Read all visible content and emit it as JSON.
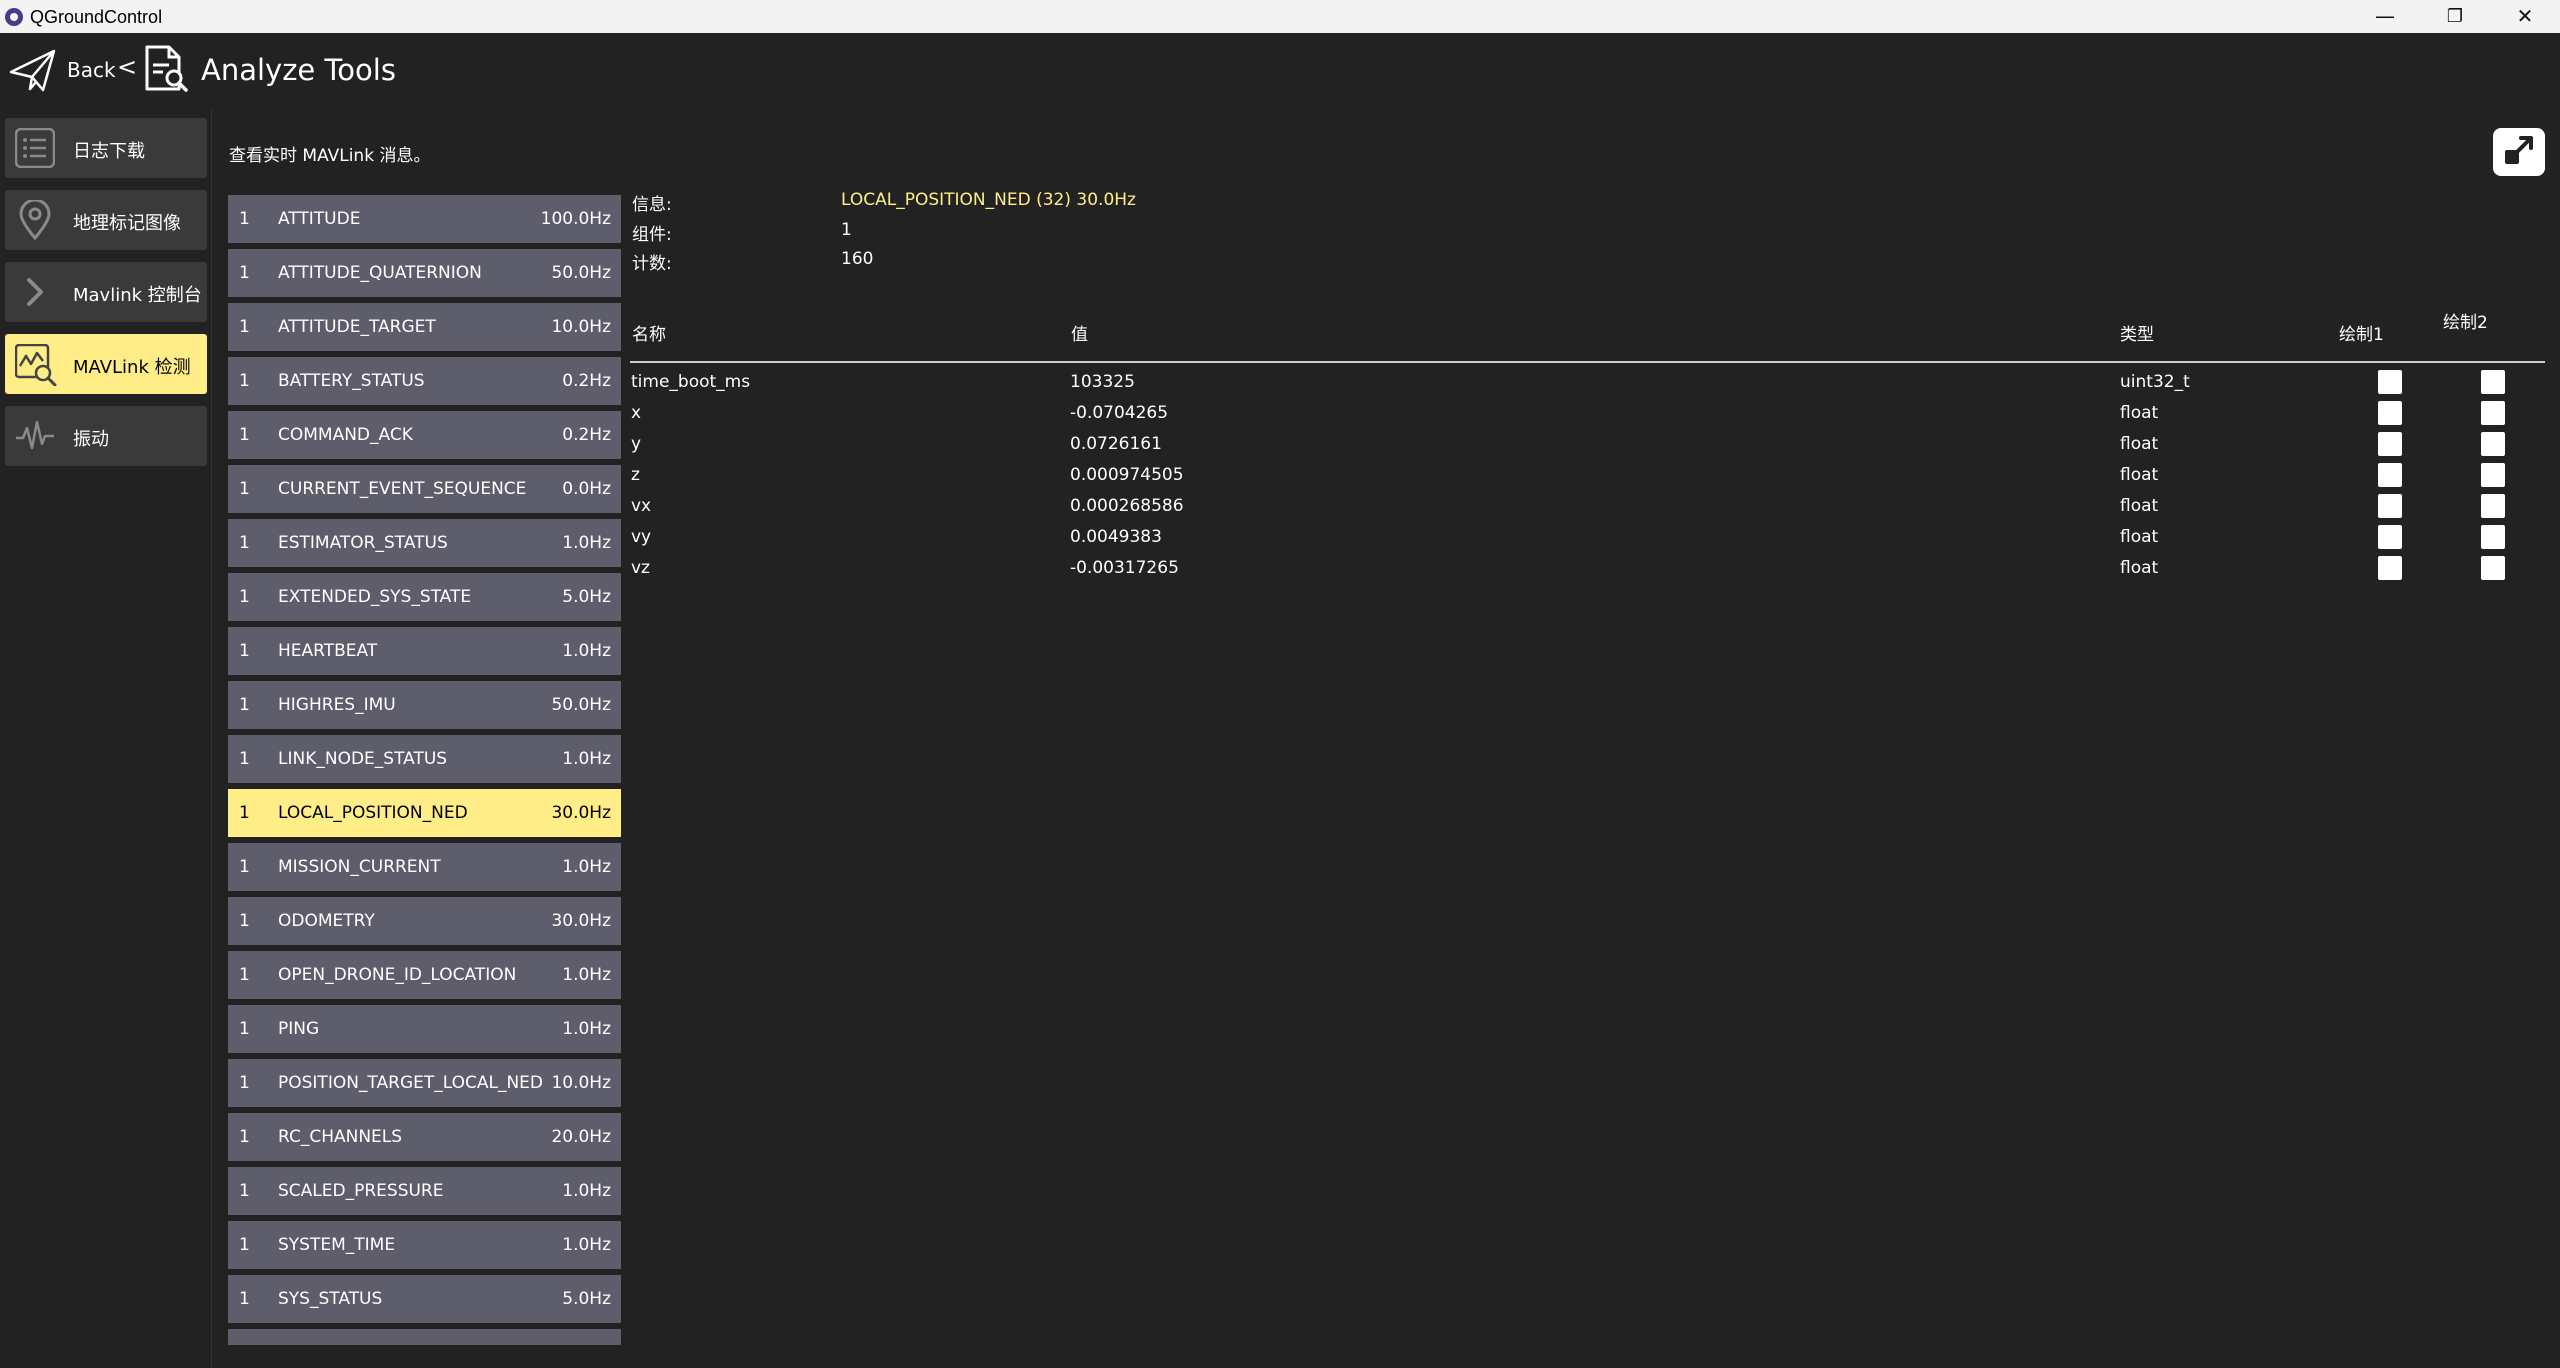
{
  "window": {
    "title": "QGroundControl",
    "minimize": "—",
    "maximize": "❐",
    "close": "✕"
  },
  "header": {
    "back_label": "Back",
    "chevron": "<",
    "page_title": "Analyze Tools"
  },
  "sidebar": {
    "items": [
      {
        "label": "日志下载",
        "icon": "list-icon",
        "active": false
      },
      {
        "label": "地理标记图像",
        "icon": "map-pin-icon",
        "active": false
      },
      {
        "label": "Mavlink 控制台",
        "icon": "chevron-right-icon",
        "active": false
      },
      {
        "label": "MAVLink 检测",
        "icon": "chart-inspect-icon",
        "active": true
      },
      {
        "label": "振动",
        "icon": "waveform-icon",
        "active": false
      }
    ]
  },
  "description": "查看实时 MAVLink 消息。",
  "messages": [
    {
      "comp": "1",
      "name": "ATTITUDE",
      "rate": "100.0Hz"
    },
    {
      "comp": "1",
      "name": "ATTITUDE_QUATERNION",
      "rate": "50.0Hz"
    },
    {
      "comp": "1",
      "name": "ATTITUDE_TARGET",
      "rate": "10.0Hz"
    },
    {
      "comp": "1",
      "name": "BATTERY_STATUS",
      "rate": "0.2Hz"
    },
    {
      "comp": "1",
      "name": "COMMAND_ACK",
      "rate": "0.2Hz"
    },
    {
      "comp": "1",
      "name": "CURRENT_EVENT_SEQUENCE",
      "rate": "0.0Hz"
    },
    {
      "comp": "1",
      "name": "ESTIMATOR_STATUS",
      "rate": "1.0Hz"
    },
    {
      "comp": "1",
      "name": "EXTENDED_SYS_STATE",
      "rate": "5.0Hz"
    },
    {
      "comp": "1",
      "name": "HEARTBEAT",
      "rate": "1.0Hz"
    },
    {
      "comp": "1",
      "name": "HIGHRES_IMU",
      "rate": "50.0Hz"
    },
    {
      "comp": "1",
      "name": "LINK_NODE_STATUS",
      "rate": "1.0Hz"
    },
    {
      "comp": "1",
      "name": "LOCAL_POSITION_NED",
      "rate": "30.0Hz",
      "selected": true
    },
    {
      "comp": "1",
      "name": "MISSION_CURRENT",
      "rate": "1.0Hz"
    },
    {
      "comp": "1",
      "name": "ODOMETRY",
      "rate": "30.0Hz"
    },
    {
      "comp": "1",
      "name": "OPEN_DRONE_ID_LOCATION",
      "rate": "1.0Hz"
    },
    {
      "comp": "1",
      "name": "PING",
      "rate": "1.0Hz"
    },
    {
      "comp": "1",
      "name": "POSITION_TARGET_LOCAL_NED",
      "rate": "10.0Hz"
    },
    {
      "comp": "1",
      "name": "RC_CHANNELS",
      "rate": "20.0Hz"
    },
    {
      "comp": "1",
      "name": "SCALED_PRESSURE",
      "rate": "1.0Hz"
    },
    {
      "comp": "1",
      "name": "SYSTEM_TIME",
      "rate": "1.0Hz"
    },
    {
      "comp": "1",
      "name": "SYS_STATUS",
      "rate": "5.0Hz"
    },
    {
      "comp": "",
      "name": "",
      "rate": ""
    }
  ],
  "detail": {
    "message_label": "信息:",
    "message_value": "LOCAL_POSITION_NED (32) 30.0Hz",
    "component_label": "组件:",
    "component_value": "1",
    "count_label": "计数:",
    "count_value": "160",
    "columns": {
      "name": "名称",
      "value": "值",
      "type": "类型",
      "plot1": "绘制1",
      "plot2": "绘制2"
    },
    "fields": [
      {
        "name": "time_boot_ms",
        "value": "103325",
        "type": "uint32_t",
        "plot1": false,
        "plot2": false
      },
      {
        "name": "x",
        "value": "-0.0704265",
        "type": "float",
        "plot1": false,
        "plot2": false
      },
      {
        "name": "y",
        "value": "0.0726161",
        "type": "float",
        "plot1": false,
        "plot2": false
      },
      {
        "name": "z",
        "value": "0.000974505",
        "type": "float",
        "plot1": false,
        "plot2": false
      },
      {
        "name": "vx",
        "value": "0.000268586",
        "type": "float",
        "plot1": false,
        "plot2": false
      },
      {
        "name": "vy",
        "value": "0.0049383",
        "type": "float",
        "plot1": false,
        "plot2": false
      },
      {
        "name": "vz",
        "value": "-0.00317265",
        "type": "float",
        "plot1": false,
        "plot2": false
      }
    ]
  },
  "colors": {
    "background": "#222222",
    "accent": "#ffee88",
    "list_row": "#5e5d6b",
    "nav_button": "#3a3a3a"
  }
}
